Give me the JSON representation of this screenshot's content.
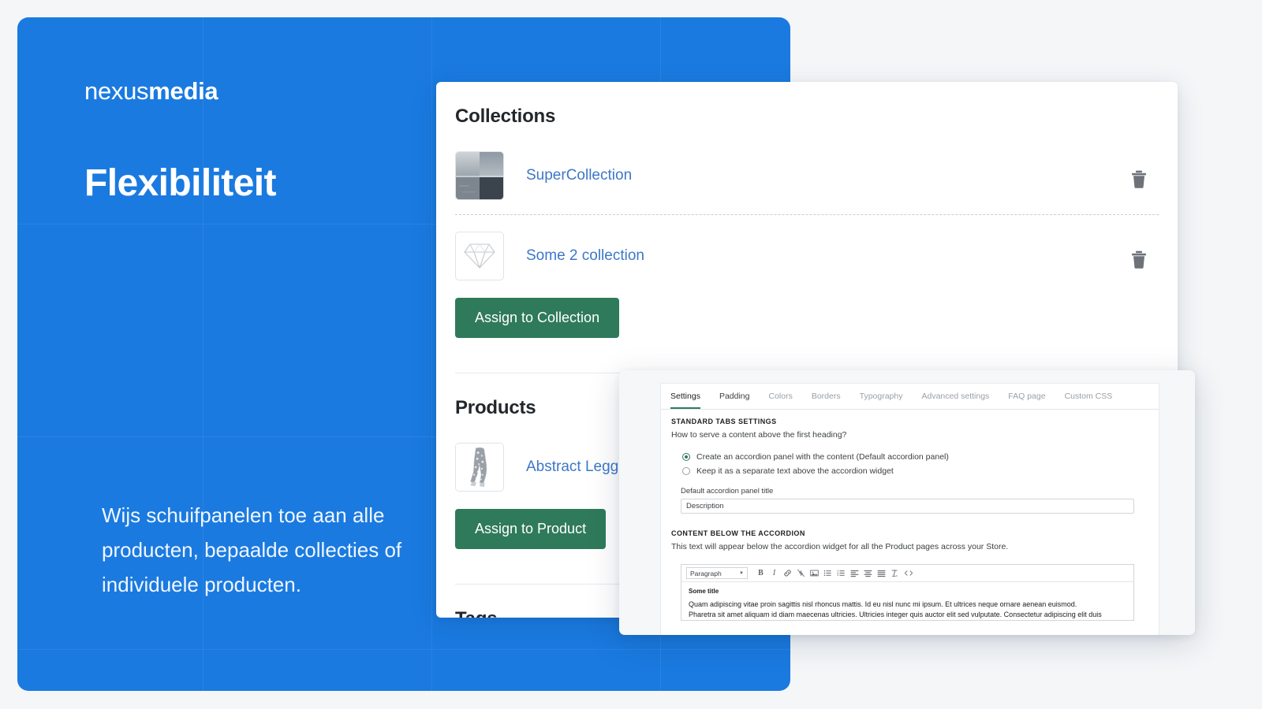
{
  "hero": {
    "logo_light": "nexus",
    "logo_bold": "media",
    "title": "Flexibiliteit",
    "body": "Wijs schuifpanelen toe aan alle producten, bepaalde collecties of individuele producten."
  },
  "collections": {
    "title": "Collections",
    "items": [
      {
        "label": "SuperCollection",
        "thumb": "seascape-photo-thumbnail",
        "delete_icon": "trash-icon"
      },
      {
        "label": "Some 2 collection",
        "thumb": "diamond-icon-thumbnail",
        "delete_icon": "trash-icon"
      }
    ],
    "assign_button": "Assign to Collection"
  },
  "products": {
    "title": "Products",
    "items": [
      {
        "label": "Abstract Leggings",
        "thumb": "leggings-photo-thumbnail"
      }
    ],
    "assign_button": "Assign to Product"
  },
  "tags": {
    "title": "Tags"
  },
  "settings": {
    "tabs": [
      {
        "label": "Settings",
        "active": true
      },
      {
        "label": "Padding",
        "active": false,
        "dark": true
      },
      {
        "label": "Colors",
        "active": false
      },
      {
        "label": "Borders",
        "active": false
      },
      {
        "label": "Typography",
        "active": false
      },
      {
        "label": "Advanced settings",
        "active": false
      },
      {
        "label": "FAQ page",
        "active": false
      },
      {
        "label": "Custom CSS",
        "active": false
      }
    ],
    "standard_tabs_heading": "STANDARD TABS SETTINGS",
    "standard_tabs_question": "How to serve a content above the first heading?",
    "radio_options": [
      {
        "label": "Create an accordion panel with the content (Default accordion panel)",
        "selected": true
      },
      {
        "label": "Keep it as a separate text above the accordion widget",
        "selected": false
      }
    ],
    "panel_title_label": "Default accordion panel title",
    "panel_title_value": "Description",
    "content_below_heading": "CONTENT BELOW THE ACCORDION",
    "content_below_desc": "This text will appear below the accordion widget for all the Product pages across your Store.",
    "editor": {
      "format_select": "Paragraph",
      "toolbar": [
        {
          "name": "bold-icon",
          "glyph": "B"
        },
        {
          "name": "italic-icon",
          "glyph": "I"
        },
        {
          "name": "link-icon",
          "glyph": "ὑ7"
        },
        {
          "name": "unlink-icon",
          "glyph": ""
        },
        {
          "name": "image-icon",
          "glyph": ""
        },
        {
          "name": "bullet-list-icon",
          "glyph": ""
        },
        {
          "name": "numbered-list-icon",
          "glyph": ""
        },
        {
          "name": "align-left-icon",
          "glyph": ""
        },
        {
          "name": "align-center-icon",
          "glyph": ""
        },
        {
          "name": "align-justify-icon",
          "glyph": ""
        },
        {
          "name": "clear-formatting-icon",
          "glyph": ""
        },
        {
          "name": "source-code-icon",
          "glyph": "<>"
        }
      ],
      "doc_title": "Some title",
      "doc_paragraph_1": "Quam adipiscing vitae proin sagittis nisl rhoncus mattis. Id eu nisl nunc mi ipsum. Et ultrices neque ornare aenean euismod.",
      "doc_paragraph_2": "Pharetra sit amet aliquam id diam maecenas ultricies. Ultricies integer quis auctor elit sed vulputate. Consectetur adipiscing elit duis"
    }
  },
  "colors": {
    "brand_blue": "#1a7ae0",
    "green_button": "#2f7a5b",
    "link_blue": "#3d77c8",
    "page_bg": "#f4f6f8"
  }
}
